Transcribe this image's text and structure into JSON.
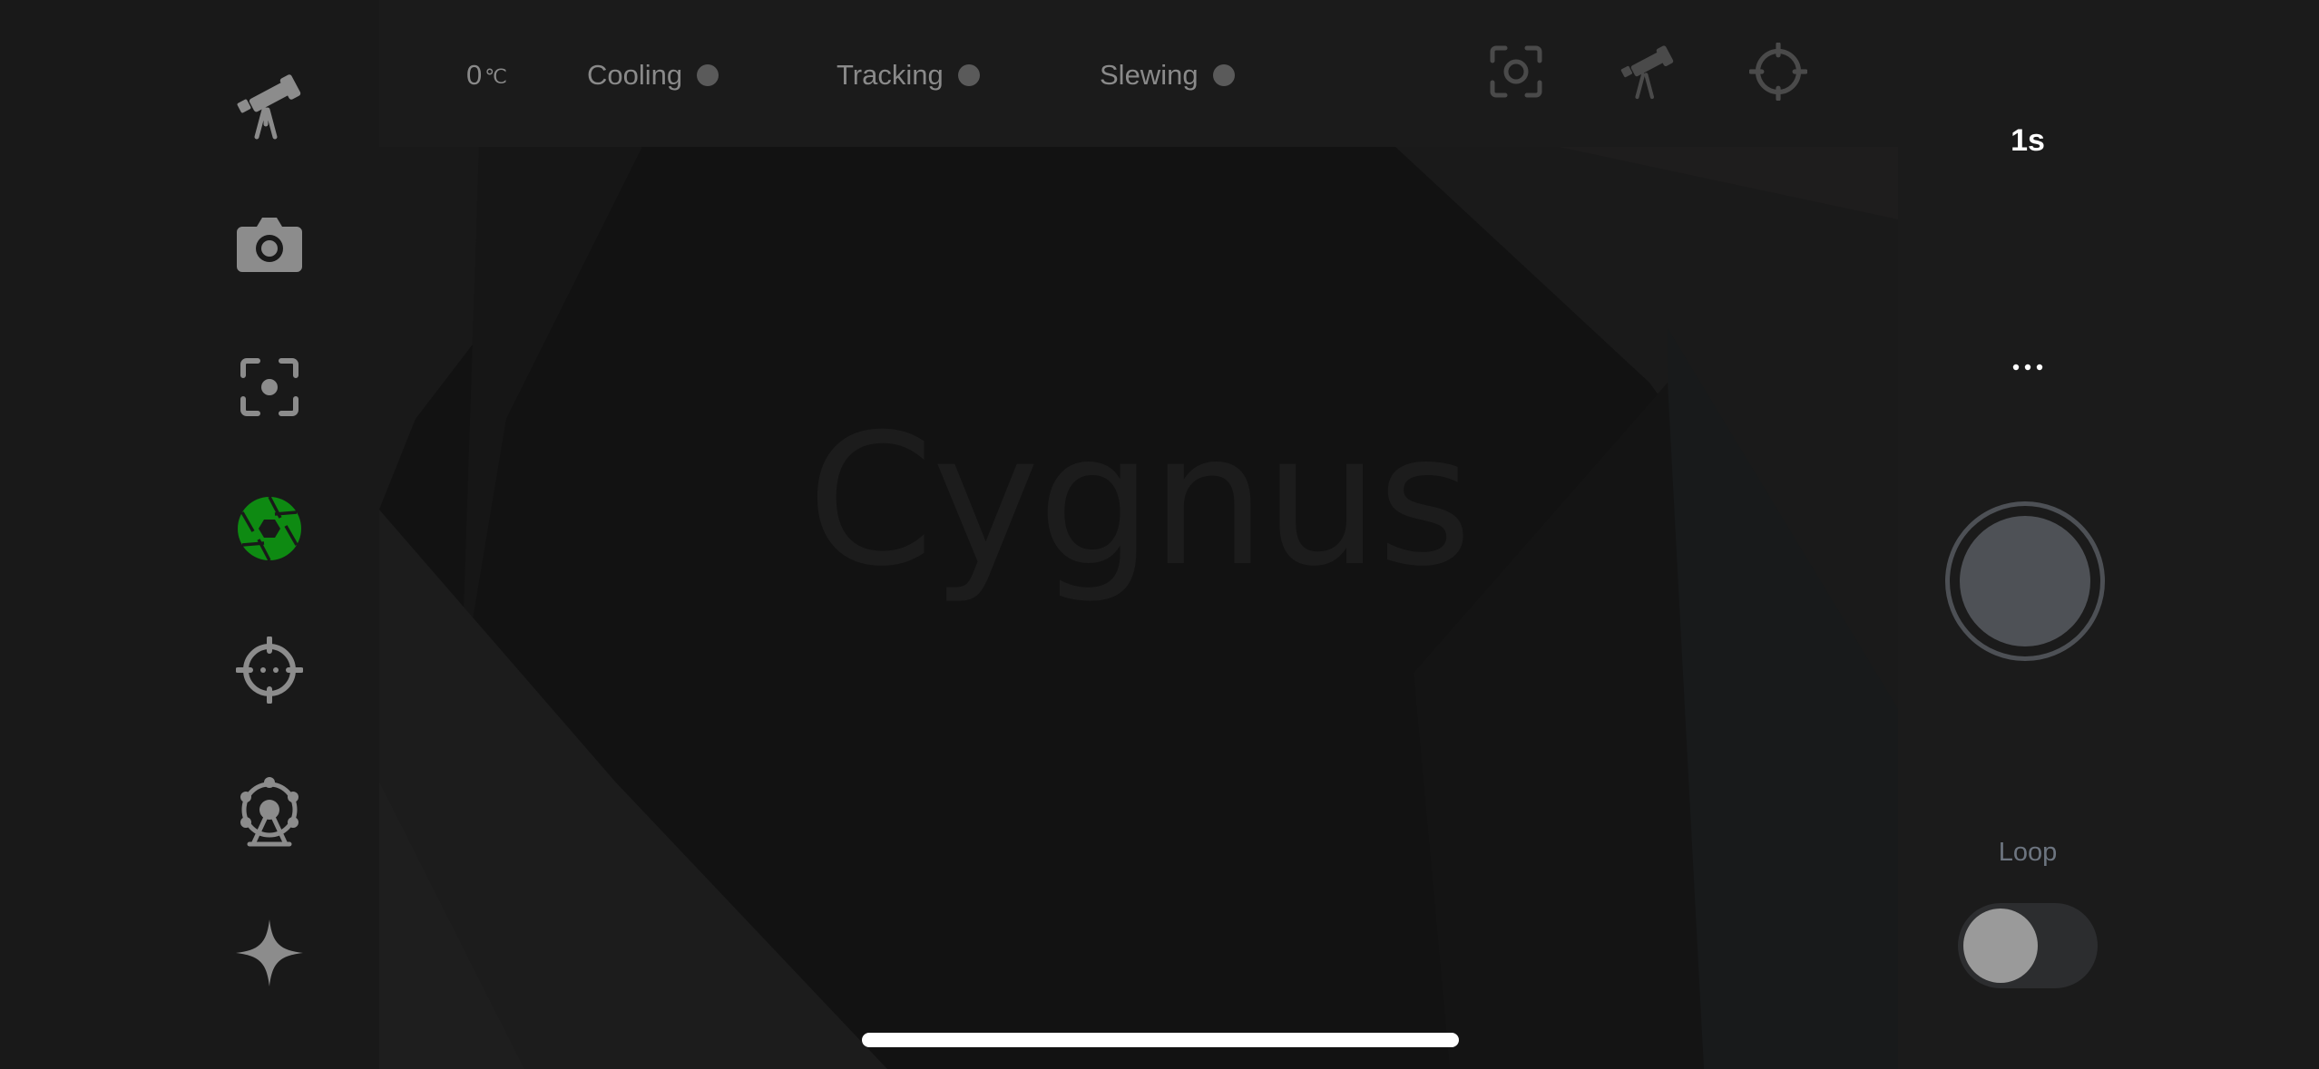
{
  "app": {
    "watermark": "Cygnus"
  },
  "sidebar": {
    "items": [
      {
        "name": "telescope",
        "icon": "telescope-icon",
        "active": false
      },
      {
        "name": "camera",
        "icon": "camera-icon",
        "active": false
      },
      {
        "name": "focus",
        "icon": "focus-icon",
        "active": false
      },
      {
        "name": "capture",
        "icon": "aperture-icon",
        "active": true
      },
      {
        "name": "guide",
        "icon": "crosshair-icon",
        "active": false
      },
      {
        "name": "mount-control",
        "icon": "ferris-wheel-icon",
        "active": false
      },
      {
        "name": "star",
        "icon": "star-icon",
        "active": false
      }
    ]
  },
  "status_bar": {
    "temperature": "0",
    "temperature_unit": "℃",
    "cooling_label": "Cooling",
    "tracking_label": "Tracking",
    "slewing_label": "Slewing",
    "icons": [
      "focus-icon",
      "telescope-icon",
      "crosshair-icon"
    ]
  },
  "capture_panel": {
    "exposure": "1s",
    "more": "···",
    "loop_label": "Loop",
    "loop_enabled": false
  },
  "colors": {
    "background": "#191919",
    "active_icon": "#0e8a12",
    "inactive_icon": "#8c8c8c",
    "status_dot": "#5a5a5a"
  }
}
